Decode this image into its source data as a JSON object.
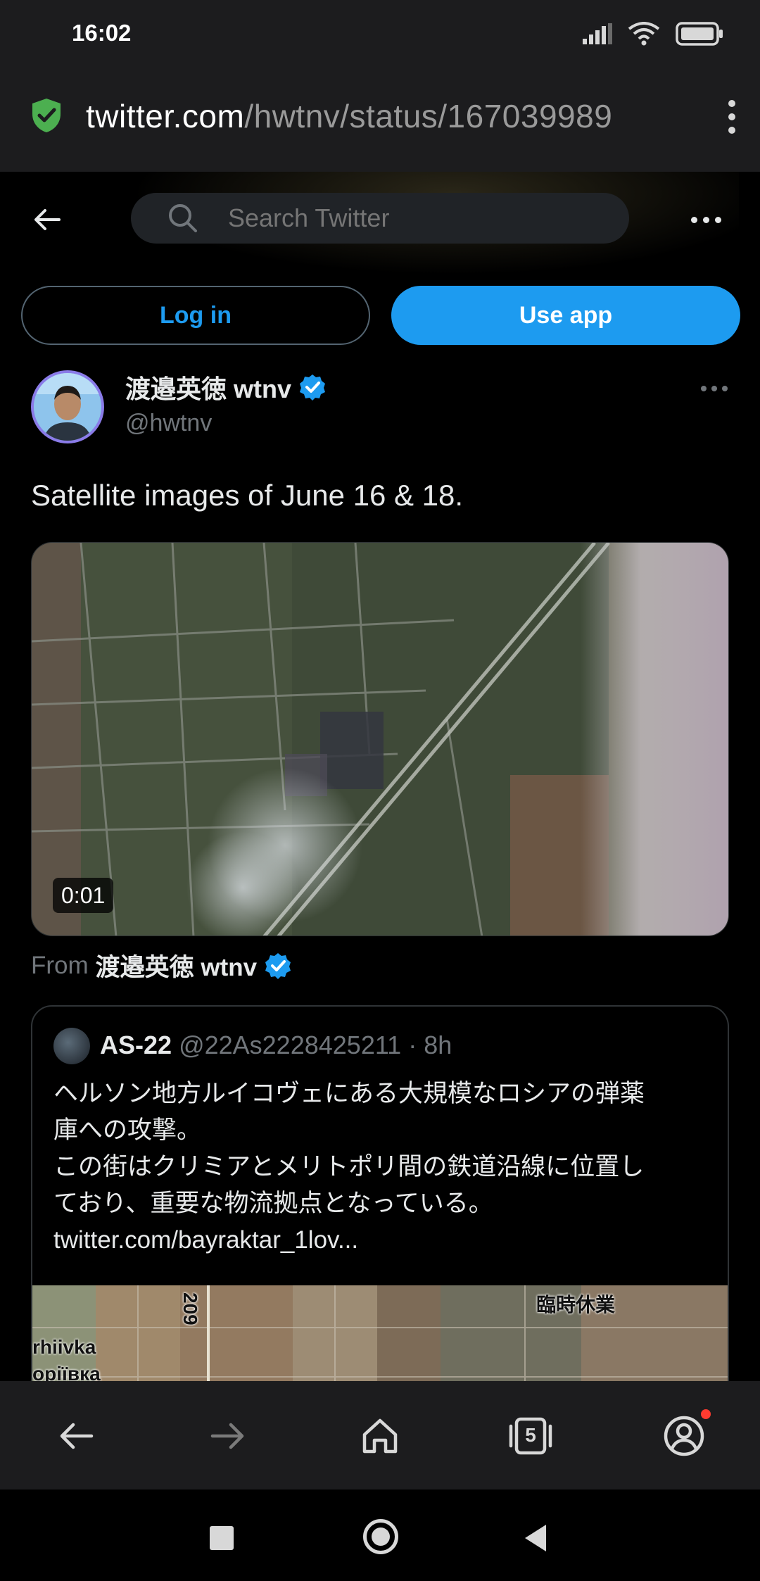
{
  "status_bar": {
    "time": "16:02",
    "icons": [
      "signal-icon",
      "wifi-icon",
      "battery-icon"
    ]
  },
  "browser": {
    "url_host": "twitter.com",
    "url_path": "/hwtnv/status/167039989",
    "tabs_count": "5",
    "secure_color": "#4caf50"
  },
  "header": {
    "search_placeholder": "Search Twitter"
  },
  "auth": {
    "login_label": "Log in",
    "use_app_label": "Use app"
  },
  "tweet": {
    "author_name": "渡邉英徳 wtnv",
    "author_handle": "@hwtnv",
    "text": "Satellite images of June 16 & 18.",
    "video_time": "0:01",
    "from_prefix": "From",
    "from_name": "渡邉英徳 wtnv"
  },
  "quote": {
    "name": "AS-22",
    "meta": "@22As2228425211 · 8h",
    "line1": "ヘルソン地方ルイコヴェにある大規模なロシアの弾薬",
    "line2": "庫への攻撃。",
    "line3": "この街はクリミアとメリトポリ間の鉄道沿線に位置し",
    "line4": "ており、重要な物流拠点となっている。",
    "link": "twitter.com/bayraktar_1lov...",
    "map_labels": {
      "road": "209",
      "village1": "rhiivka",
      "village2": "оріївка",
      "closed": "臨時休業"
    }
  },
  "colors": {
    "accent": "#1d9bf0",
    "background": "#000000",
    "muted": "#71767b"
  }
}
